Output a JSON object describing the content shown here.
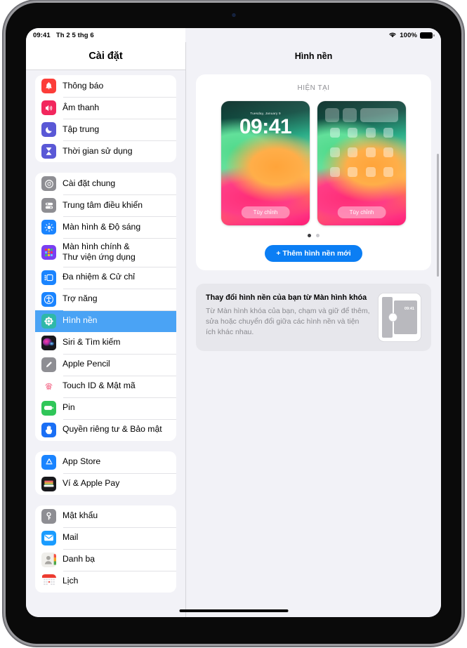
{
  "status_bar": {
    "time": "09:41",
    "date": "Th 2 5 thg 6",
    "wifi_icon": "wifi-icon",
    "battery_percent": "100%",
    "battery_icon": "battery-full-icon"
  },
  "sidebar": {
    "title": "Cài đặt",
    "groups": [
      {
        "items": [
          {
            "label": "Thông báo",
            "icon": "notifications-bell-icon",
            "selected": false
          },
          {
            "label": "Âm thanh",
            "icon": "sound-speaker-icon",
            "selected": false
          },
          {
            "label": "Tập trung",
            "icon": "focus-moon-icon",
            "selected": false
          },
          {
            "label": "Thời gian sử dụng",
            "icon": "screen-time-hourglass-icon",
            "selected": false
          }
        ]
      },
      {
        "items": [
          {
            "label": "Cài đặt chung",
            "icon": "general-gear-icon",
            "selected": false
          },
          {
            "label": "Trung tâm điều khiển",
            "icon": "control-center-icon",
            "selected": false
          },
          {
            "label": "Màn hình & Độ sáng",
            "icon": "display-brightness-icon",
            "selected": false
          },
          {
            "label": "Màn hình chính &\nThư viện ứng dụng",
            "icon": "home-screen-app-library-icon",
            "selected": false
          },
          {
            "label": "Đa nhiệm & Cử chỉ",
            "icon": "multitasking-gestures-icon",
            "selected": false
          },
          {
            "label": "Trợ năng",
            "icon": "accessibility-icon",
            "selected": false
          },
          {
            "label": "Hình nền",
            "icon": "wallpaper-icon",
            "selected": true
          },
          {
            "label": "Siri & Tìm kiếm",
            "icon": "siri-icon",
            "selected": false
          },
          {
            "label": "Apple Pencil",
            "icon": "apple-pencil-icon",
            "selected": false
          },
          {
            "label": "Touch ID & Mật mã",
            "icon": "touch-id-icon",
            "selected": false
          },
          {
            "label": "Pin",
            "icon": "battery-icon",
            "selected": false
          },
          {
            "label": "Quyền riêng tư & Bảo mật",
            "icon": "privacy-hand-icon",
            "selected": false
          }
        ]
      },
      {
        "items": [
          {
            "label": "App Store",
            "icon": "app-store-icon",
            "selected": false
          },
          {
            "label": "Ví & Apple Pay",
            "icon": "wallet-icon",
            "selected": false
          }
        ]
      },
      {
        "items": [
          {
            "label": "Mật khẩu",
            "icon": "passwords-key-icon",
            "selected": false
          },
          {
            "label": "Mail",
            "icon": "mail-icon",
            "selected": false
          },
          {
            "label": "Danh bạ",
            "icon": "contacts-icon",
            "selected": false
          },
          {
            "label": "Lịch",
            "icon": "calendar-icon",
            "selected": false
          }
        ]
      }
    ]
  },
  "detail": {
    "title": "Hình nền",
    "current_section_label": "HIỆN TẠI",
    "previews": {
      "lock_screen": {
        "name": "lock-screen-preview",
        "date": "Tuesday, January 9",
        "time": "09:41",
        "customize_label": "Tùy chỉnh"
      },
      "home_screen": {
        "name": "home-screen-preview",
        "customize_label": "Tùy chỉnh"
      }
    },
    "page_dots": {
      "count": 2,
      "active_index": 0
    },
    "add_button_label": "+ Thêm hình nền mới",
    "tip_card": {
      "title": "Thay đổi hình nền của bạn từ Màn hình khóa",
      "body": "Từ Màn hình khóa của bạn, chạm và giữ để thêm, sửa hoặc chuyển đổi giữa các hình nền và tiện ích khác nhau.",
      "figure_time": "09:41"
    }
  },
  "colors": {
    "accent_blue": "#0b7ef4",
    "selected_row": "#4aa3f5",
    "screen_bg": "#f2f2f7",
    "card_bg": "#ffffff",
    "tip_bg": "#e7e7ec"
  }
}
